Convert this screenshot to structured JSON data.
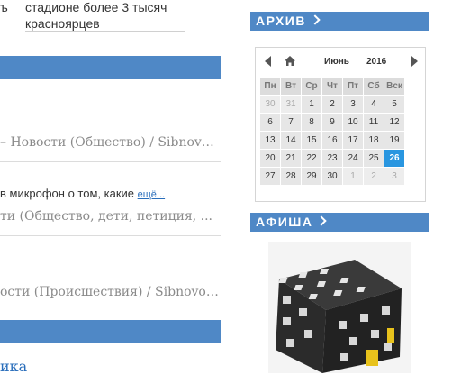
{
  "left": {
    "article_text_fragment": "ъ",
    "stadium_line1": "стадионе более 3 тысяч",
    "stadium_line2": "красноярцев",
    "row1_meta": "– Новости (Общество) / Sibnov…",
    "row2_text": "в микрофон о том, какие",
    "row2_more": "ещё...",
    "row2_meta": "ти (Общество, дети, петиция, ...",
    "row3_meta": "ости (Происшествия) / Sibnovo…",
    "bottom_link": "ика"
  },
  "archive": {
    "title": "АРХИВ",
    "month": "Июнь",
    "year": "2016",
    "weekdays": [
      "Пн",
      "Вт",
      "Ср",
      "Чт",
      "Пт",
      "Сб",
      "Вск"
    ],
    "weeks": [
      [
        {
          "d": "30",
          "t": "oth"
        },
        {
          "d": "31",
          "t": "oth"
        },
        {
          "d": "1",
          "t": "cur"
        },
        {
          "d": "2",
          "t": "cur"
        },
        {
          "d": "3",
          "t": "cur"
        },
        {
          "d": "4",
          "t": "cur"
        },
        {
          "d": "5",
          "t": "cur"
        }
      ],
      [
        {
          "d": "6",
          "t": "cur"
        },
        {
          "d": "7",
          "t": "cur"
        },
        {
          "d": "8",
          "t": "cur"
        },
        {
          "d": "9",
          "t": "cur"
        },
        {
          "d": "10",
          "t": "cur"
        },
        {
          "d": "11",
          "t": "cur"
        },
        {
          "d": "12",
          "t": "cur"
        }
      ],
      [
        {
          "d": "13",
          "t": "cur"
        },
        {
          "d": "14",
          "t": "cur"
        },
        {
          "d": "15",
          "t": "cur"
        },
        {
          "d": "16",
          "t": "cur"
        },
        {
          "d": "17",
          "t": "cur"
        },
        {
          "d": "18",
          "t": "cur"
        },
        {
          "d": "19",
          "t": "cur"
        }
      ],
      [
        {
          "d": "20",
          "t": "cur"
        },
        {
          "d": "21",
          "t": "cur"
        },
        {
          "d": "22",
          "t": "cur"
        },
        {
          "d": "23",
          "t": "cur"
        },
        {
          "d": "24",
          "t": "cur"
        },
        {
          "d": "25",
          "t": "cur"
        },
        {
          "d": "26",
          "t": "tod"
        }
      ],
      [
        {
          "d": "27",
          "t": "cur"
        },
        {
          "d": "28",
          "t": "cur"
        },
        {
          "d": "29",
          "t": "cur"
        },
        {
          "d": "30",
          "t": "cur"
        },
        {
          "d": "1",
          "t": "oth"
        },
        {
          "d": "2",
          "t": "oth"
        },
        {
          "d": "3",
          "t": "oth"
        }
      ]
    ]
  },
  "afisha": {
    "title": "АФИША"
  },
  "colors": {
    "accent": "#4f88c6",
    "today": "#2996e0",
    "link": "#2a6ebb"
  }
}
